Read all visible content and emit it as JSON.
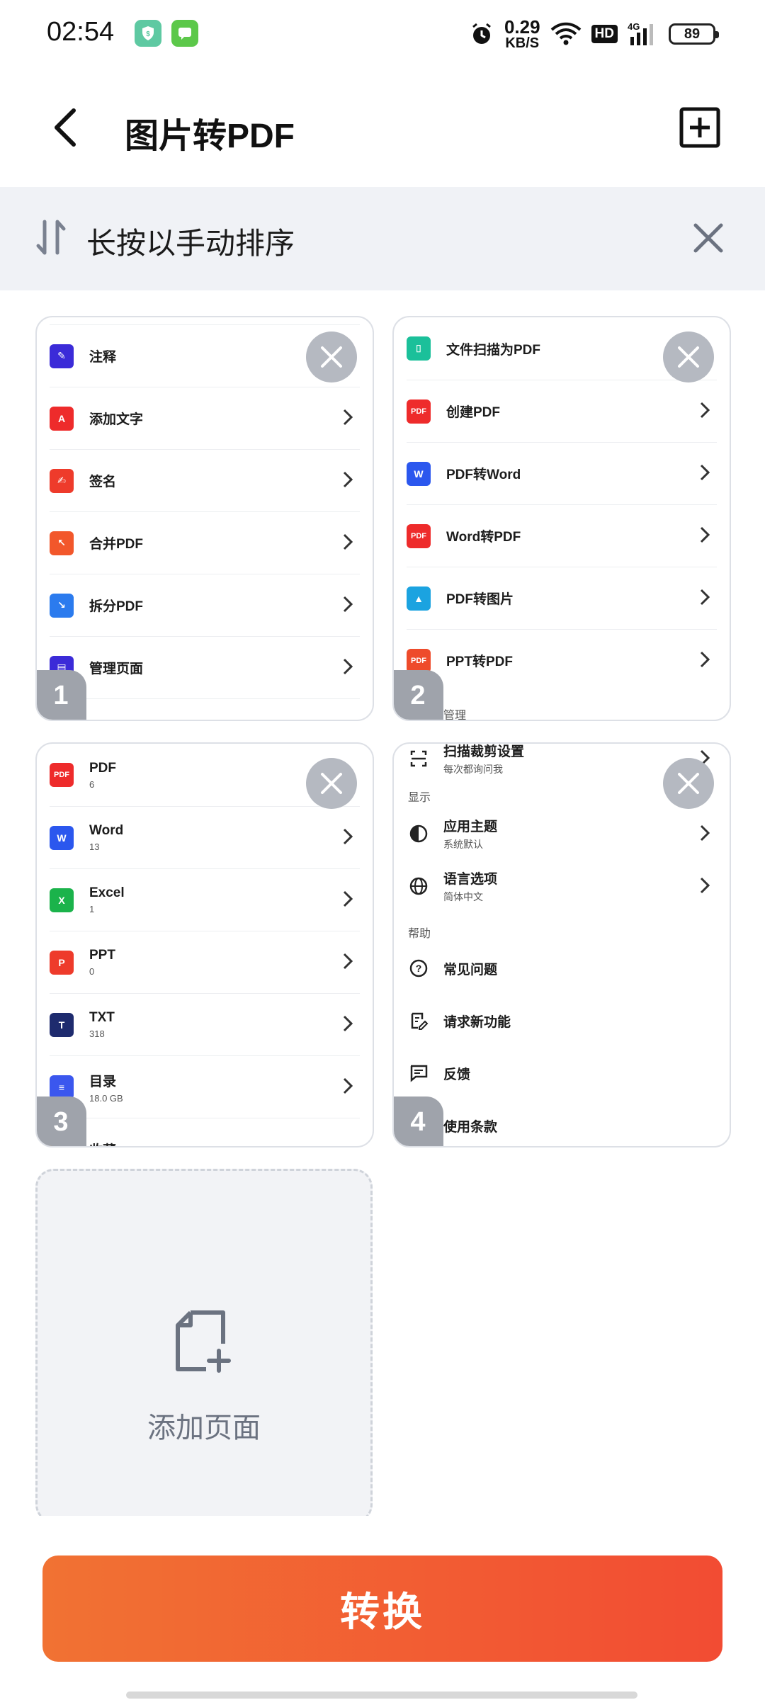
{
  "status_bar": {
    "time": "02:54",
    "net_speed_value": "0.29",
    "net_speed_unit": "KB/S",
    "hd": "HD",
    "network": "4G",
    "battery": "89"
  },
  "header": {
    "title": "图片转PDF"
  },
  "sort_banner": {
    "text": "长按以手动排序"
  },
  "thumbnails": [
    {
      "number": "1",
      "items": [
        {
          "label": "注释",
          "icon": "annotate-icon",
          "color": "#3b2bd8"
        },
        {
          "label": "添加文字",
          "icon": "add-text-icon",
          "color": "#ee2b2b"
        },
        {
          "label": "签名",
          "icon": "signature-icon",
          "color": "#ee3b2b"
        },
        {
          "label": "合并PDF",
          "icon": "merge-icon",
          "color": "#f2572b"
        },
        {
          "label": "拆分PDF",
          "icon": "split-icon",
          "color": "#2b7bee"
        },
        {
          "label": "管理页面",
          "icon": "manage-pages-icon",
          "color": "#3b2bd8"
        }
      ]
    },
    {
      "number": "2",
      "items": [
        {
          "label": "文件扫描为PDF",
          "icon": "scan-icon",
          "color": "#1bc09a"
        },
        {
          "label": "创建PDF",
          "icon": "create-pdf-icon",
          "color": "#ee2b2b"
        },
        {
          "label": "PDF转Word",
          "icon": "pdf-to-word-icon",
          "color": "#2b57ee"
        },
        {
          "label": "Word转PDF",
          "icon": "word-to-pdf-icon",
          "color": "#ee2b2b"
        },
        {
          "label": "PDF转图片",
          "icon": "pdf-to-image-icon",
          "color": "#1ba3e0"
        },
        {
          "label": "PPT转PDF",
          "icon": "ppt-to-pdf-icon",
          "color": "#ee4b2b"
        }
      ],
      "footer": "编辑和管理"
    },
    {
      "number": "3",
      "items": [
        {
          "label": "PDF",
          "sub": "6",
          "icon": "pdf-file-icon",
          "badge": "PDF",
          "color": "#ee2b2b"
        },
        {
          "label": "Word",
          "sub": "13",
          "icon": "word-file-icon",
          "badge": "W",
          "color": "#2b57ee"
        },
        {
          "label": "Excel",
          "sub": "1",
          "icon": "excel-file-icon",
          "badge": "X",
          "color": "#1bb34b"
        },
        {
          "label": "PPT",
          "sub": "0",
          "icon": "ppt-file-icon",
          "badge": "P",
          "color": "#ee3b2b"
        },
        {
          "label": "TXT",
          "sub": "318",
          "icon": "txt-file-icon",
          "badge": "T",
          "color": "#1e2b6e"
        },
        {
          "label": "目录",
          "sub": "18.0 GB",
          "icon": "directory-icon",
          "badge": "≡",
          "color": "#3b57ee"
        }
      ],
      "footer": "收藏"
    },
    {
      "number": "4",
      "top_cut": "扫描裁剪设置",
      "top_cut_sub": "每次都询问我",
      "section_display": "显示",
      "theme_label": "应用主题",
      "theme_sub": "系统默认",
      "language_label": "语言选项",
      "language_sub": "简体中文",
      "section_help": "帮助",
      "faq": "常见问题",
      "request": "请求新功能",
      "feedback": "反馈",
      "terms": "使用条款"
    }
  ],
  "add_page": {
    "label": "添加页面"
  },
  "convert_button": {
    "label": "转换"
  }
}
